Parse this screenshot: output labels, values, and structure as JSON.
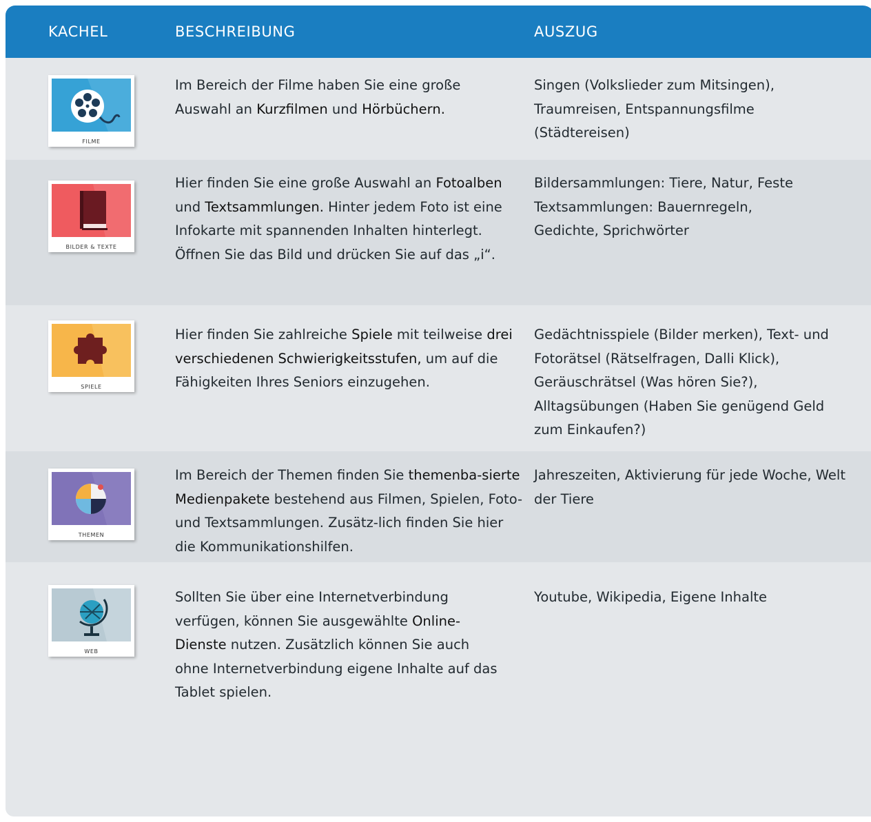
{
  "header": {
    "col_tile": "KACHEL",
    "col_description": "BESCHREIBUNG",
    "col_excerpt": "AUSZUG"
  },
  "colors": {
    "header": "#1a7ec1",
    "filme": "#36a2d6",
    "bilder": "#ef5b5f",
    "spiele": "#f7b64a",
    "themen": "#8073b8",
    "web": "#b8cad3"
  },
  "rows": [
    {
      "tile_label": "FILME",
      "tile_icon": "film-reel-icon",
      "desc": {
        "p1": "Im Bereich der Filme haben Sie eine große Auswahl an ",
        "b1": "Kurzfilmen",
        "p2": " und ",
        "b2": "Hörbüchern."
      },
      "excerpt": "Singen (Volkslieder zum Mitsingen), Traumreisen, Entspannungsfilme (Städtereisen)"
    },
    {
      "tile_label": "BILDER & TEXTE",
      "tile_icon": "book-icon",
      "desc": {
        "p1": "Hier finden Sie eine große Auswahl an ",
        "b1": "Fotoalben",
        "p2": " und ",
        "b2": "Textsammlungen.",
        "p3": " Hinter jedem Foto ist eine Infokarte mit spannenden Inhalten hinterlegt. Öffnen Sie das Bild und drücken Sie auf das „i“."
      },
      "excerpt_line1": "Bildersammlungen: Tiere, Natur, Feste",
      "excerpt_line2": "Textsammlungen: Bauernregeln, Gedichte, Sprichwörter"
    },
    {
      "tile_label": "SPIELE",
      "tile_icon": "puzzle-piece-icon",
      "desc": {
        "p1": "Hier finden Sie zahlreiche ",
        "b1": "Spiele",
        "p2": " mit teilweise ",
        "b2": "drei verschiedenen Schwierigkeitsstufen,",
        "p3": " um auf die Fähigkeiten Ihres Seniors einzugehen."
      },
      "excerpt": "Gedächtnisspiele (Bilder merken), Text- und Fotorätsel (Rätselfragen, Dalli Klick), Geräuschrätsel (Was hören Sie?), Alltagsübungen (Haben Sie genügend Geld zum Einkaufen?)"
    },
    {
      "tile_label": "THEMEN",
      "tile_icon": "beach-ball-icon",
      "desc": {
        "p1": "Im Bereich der Themen finden Sie ",
        "b1": "themenba-sierte Medienpakete",
        "p2": " bestehend aus Filmen, Spielen, Foto- und Textsammlungen. Zusätz-lich finden Sie hier die Kommunikationshilfen."
      },
      "excerpt": "Jahreszeiten, Aktivierung für jede Woche, Welt der Tiere"
    },
    {
      "tile_label": "WEB",
      "tile_icon": "globe-icon",
      "desc": {
        "p1": "Sollten Sie über eine Internetverbindung verfügen, können Sie ausgewählte ",
        "b1": "Online-Dienste",
        "p2": " nutzen. Zusätzlich können Sie auch ohne Internetverbindung eigene Inhalte auf das Tablet spielen."
      },
      "excerpt": "Youtube, Wikipedia, Eigene Inhalte"
    }
  ]
}
